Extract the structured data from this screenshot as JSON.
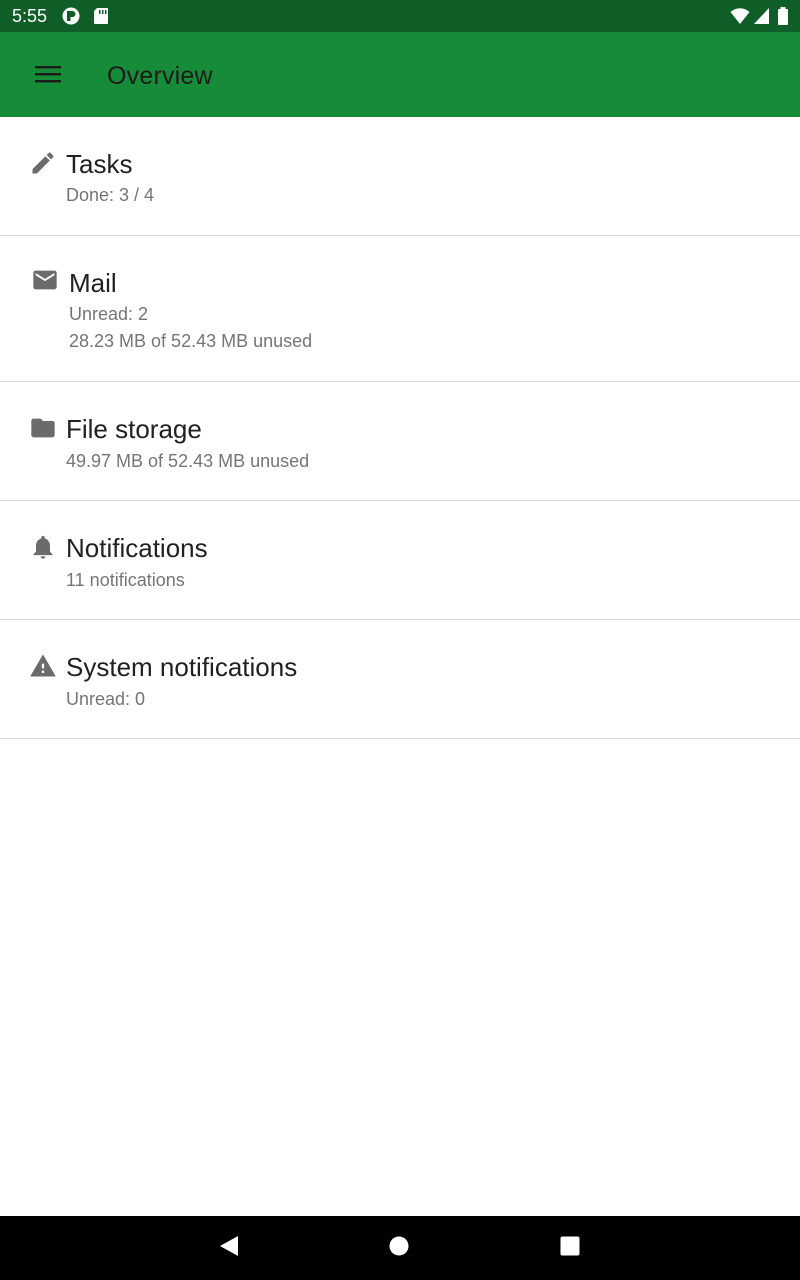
{
  "status_bar": {
    "time": "5:55",
    "left_icons": [
      "app-notification-icon",
      "sd-card-icon"
    ],
    "right_icons": [
      "wifi-icon",
      "cell-signal-icon",
      "battery-icon"
    ]
  },
  "app_bar": {
    "menu_icon": "menu-icon",
    "title": "Overview",
    "color": "#178c38"
  },
  "items": [
    {
      "icon": "pencil-icon",
      "title": "Tasks",
      "lines": [
        "Done: 3 / 4"
      ]
    },
    {
      "icon": "mail-icon",
      "title": "Mail",
      "lines": [
        "Unread: 2",
        "28.23 MB of 52.43 MB unused"
      ]
    },
    {
      "icon": "folder-icon",
      "title": "File storage",
      "lines": [
        "49.97 MB of 52.43 MB unused"
      ]
    },
    {
      "icon": "bell-icon",
      "title": "Notifications",
      "lines": [
        "11 notifications"
      ]
    },
    {
      "icon": "warning-icon",
      "title": "System notifications",
      "lines": [
        "Unread: 0"
      ]
    }
  ],
  "nav_bar": {
    "buttons": [
      "back-icon",
      "home-icon",
      "recents-icon"
    ]
  }
}
